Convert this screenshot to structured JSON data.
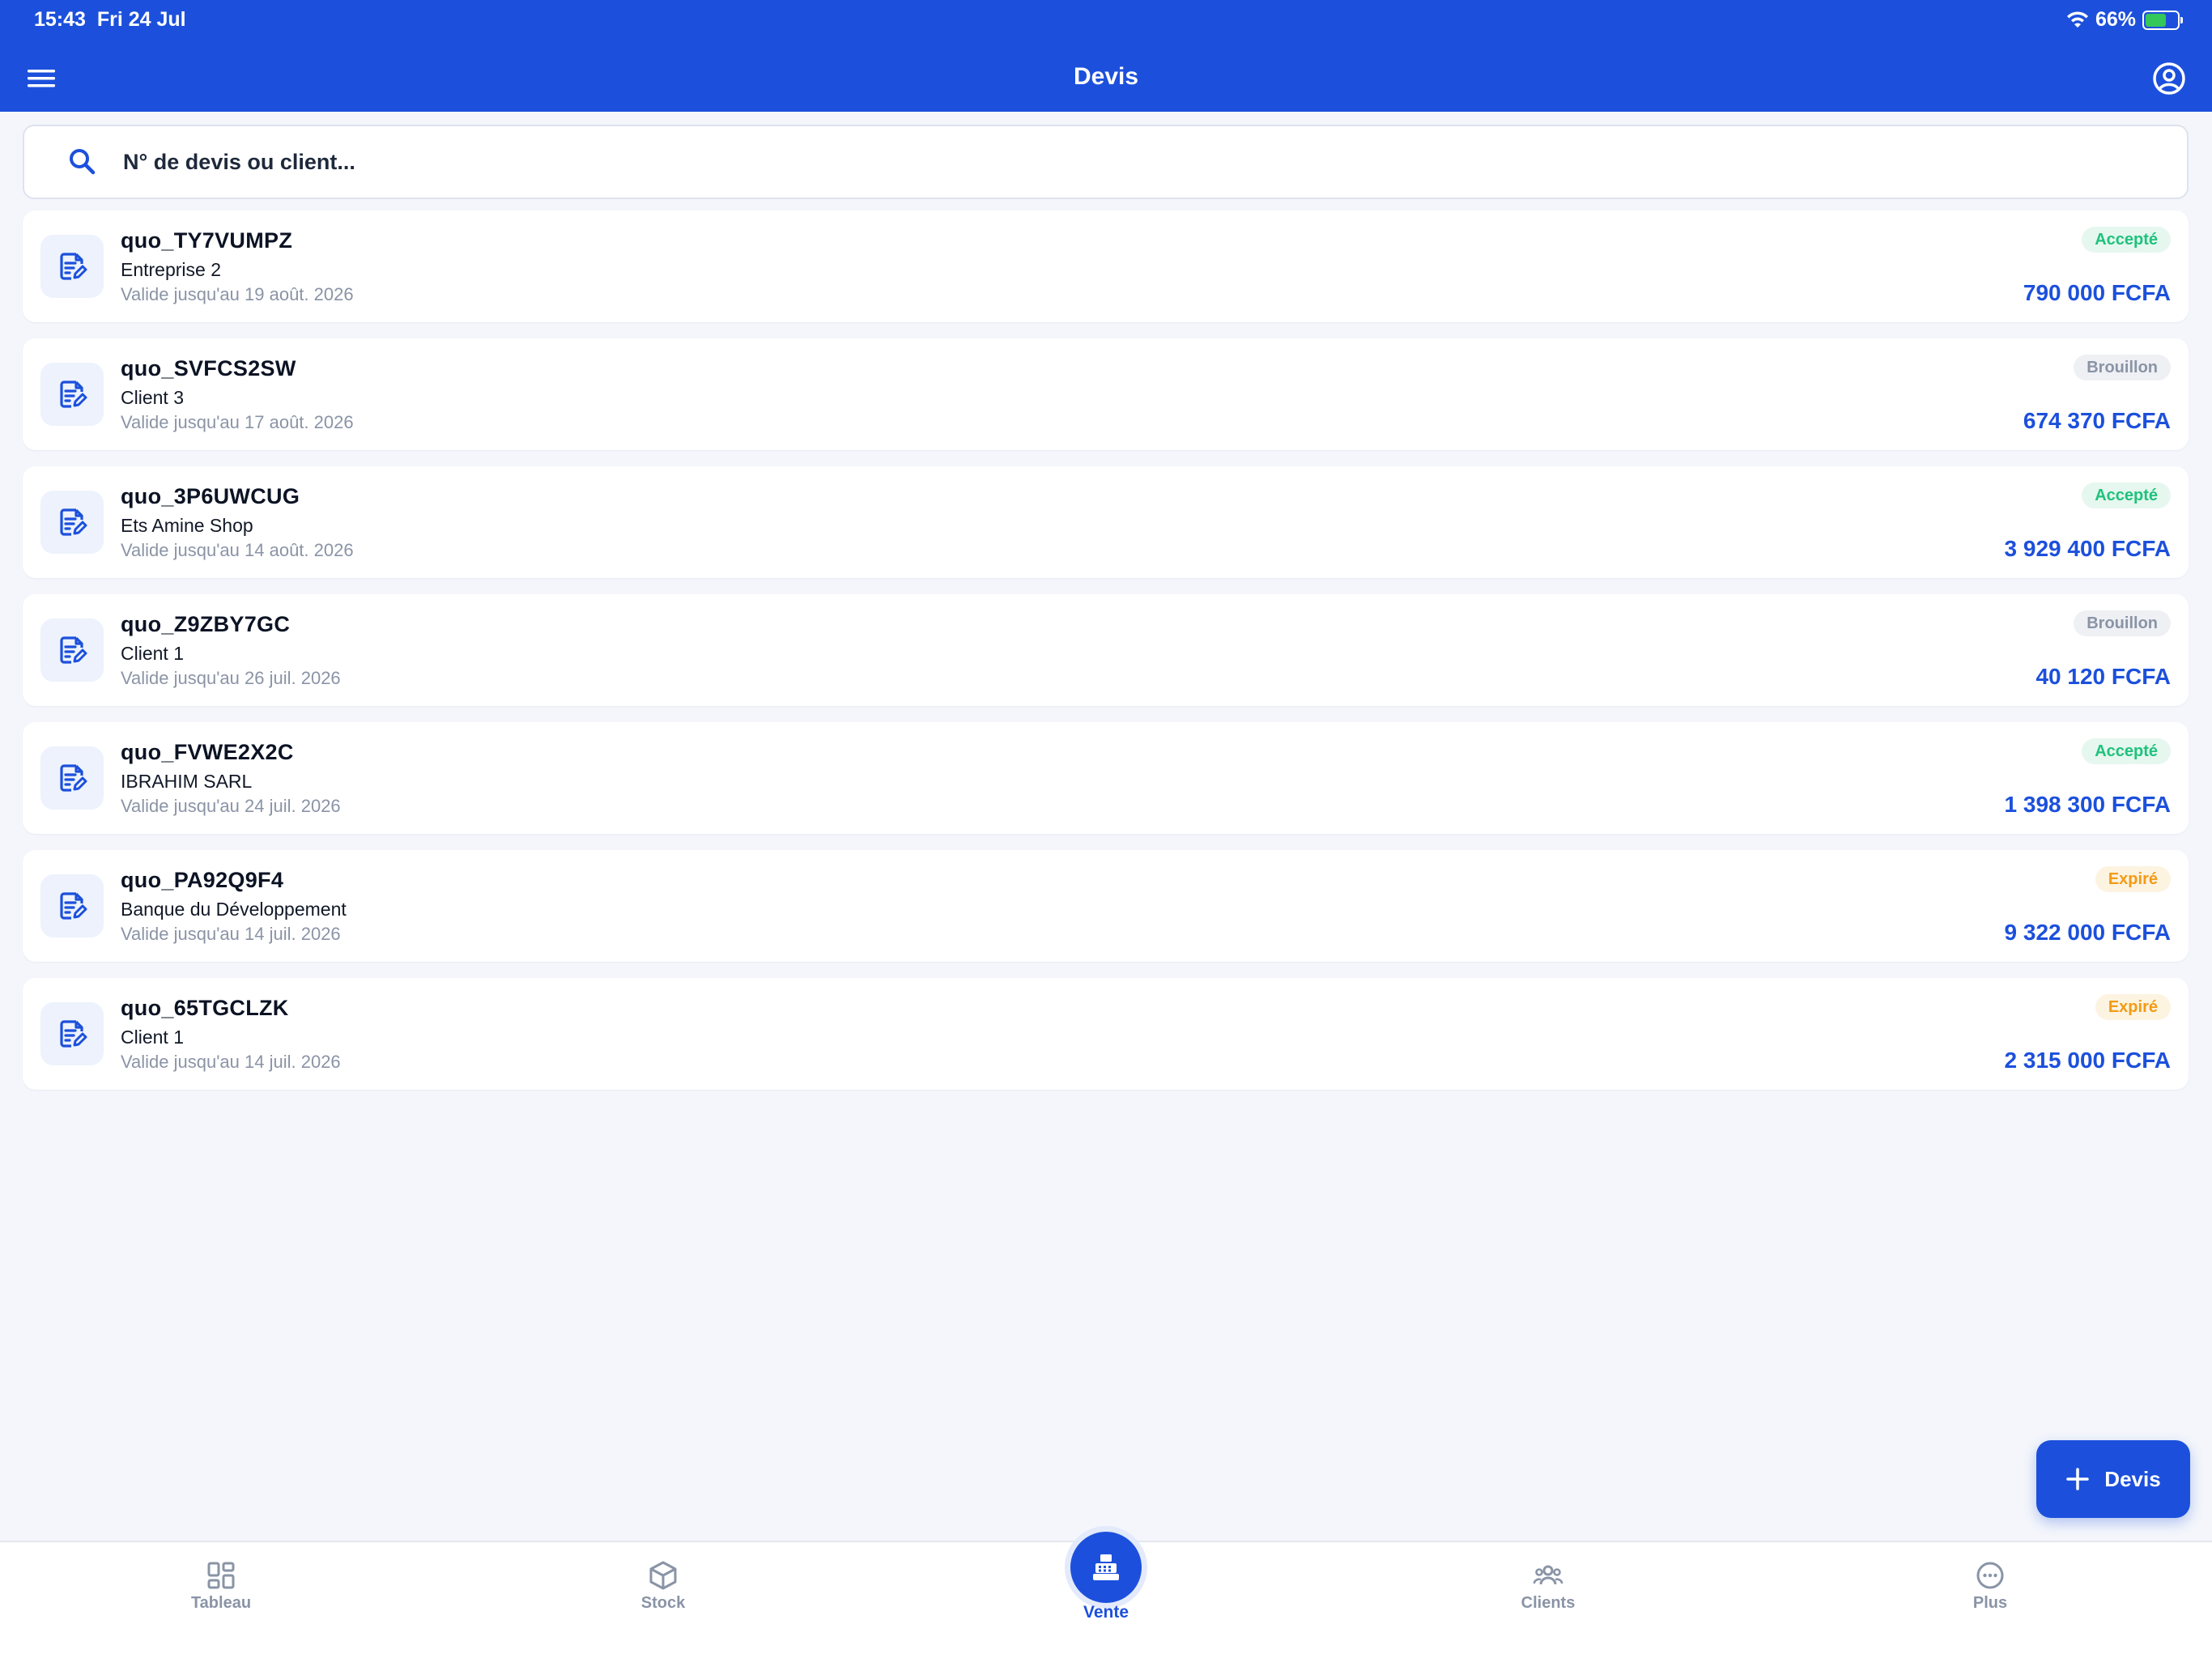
{
  "status_bar": {
    "time": "15:43",
    "date": "Fri 24 Jul",
    "battery": "66%",
    "battery_level": 0.66
  },
  "header": {
    "title": "Devis"
  },
  "search": {
    "placeholder": "N° de devis ou client..."
  },
  "colors": {
    "primary": "#1c50dc",
    "accepted": "#1fc27c",
    "draft": "#8a94a6",
    "expired": "#f29b16",
    "background": "#f4f6fb"
  },
  "quotes": [
    {
      "id": "quo_TY7VUMPZ",
      "client": "Entreprise 2",
      "validity": "Valide jusqu'au 19 août. 2026",
      "status": "Accepté",
      "amount": "790 000 FCFA"
    },
    {
      "id": "quo_SVFCS2SW",
      "client": "Client 3",
      "validity": "Valide jusqu'au 17 août. 2026",
      "status": "Brouillon",
      "amount": "674 370 FCFA"
    },
    {
      "id": "quo_3P6UWCUG",
      "client": "Ets Amine Shop",
      "validity": "Valide jusqu'au 14 août. 2026",
      "status": "Accepté",
      "amount": "3 929 400 FCFA"
    },
    {
      "id": "quo_Z9ZBY7GC",
      "client": "Client 1",
      "validity": "Valide jusqu'au 26 juil. 2026",
      "status": "Brouillon",
      "amount": "40 120 FCFA"
    },
    {
      "id": "quo_FVWE2X2C",
      "client": "IBRAHIM SARL",
      "validity": "Valide jusqu'au 24 juil. 2026",
      "status": "Accepté",
      "amount": "1 398 300 FCFA"
    },
    {
      "id": "quo_PA92Q9F4",
      "client": "Banque du Développement",
      "validity": "Valide jusqu'au 14 juil. 2026",
      "status": "Expiré",
      "amount": "9 322 000 FCFA"
    },
    {
      "id": "quo_65TGCLZK",
      "client": "Client 1",
      "validity": "Valide jusqu'au 14 juil. 2026",
      "status": "Expiré",
      "amount": "2 315 000 FCFA"
    }
  ],
  "fab": {
    "label": "Devis",
    "icon": "plus-icon"
  },
  "tabs": {
    "tableau": {
      "label": "Tableau",
      "icon": "dashboard-icon"
    },
    "stock": {
      "label": "Stock",
      "icon": "box-icon"
    },
    "vente": {
      "label": "Vente",
      "icon": "cash-register-icon",
      "active": true
    },
    "clients": {
      "label": "Clients",
      "icon": "users-icon"
    },
    "plus": {
      "label": "Plus",
      "icon": "more-icon"
    }
  }
}
